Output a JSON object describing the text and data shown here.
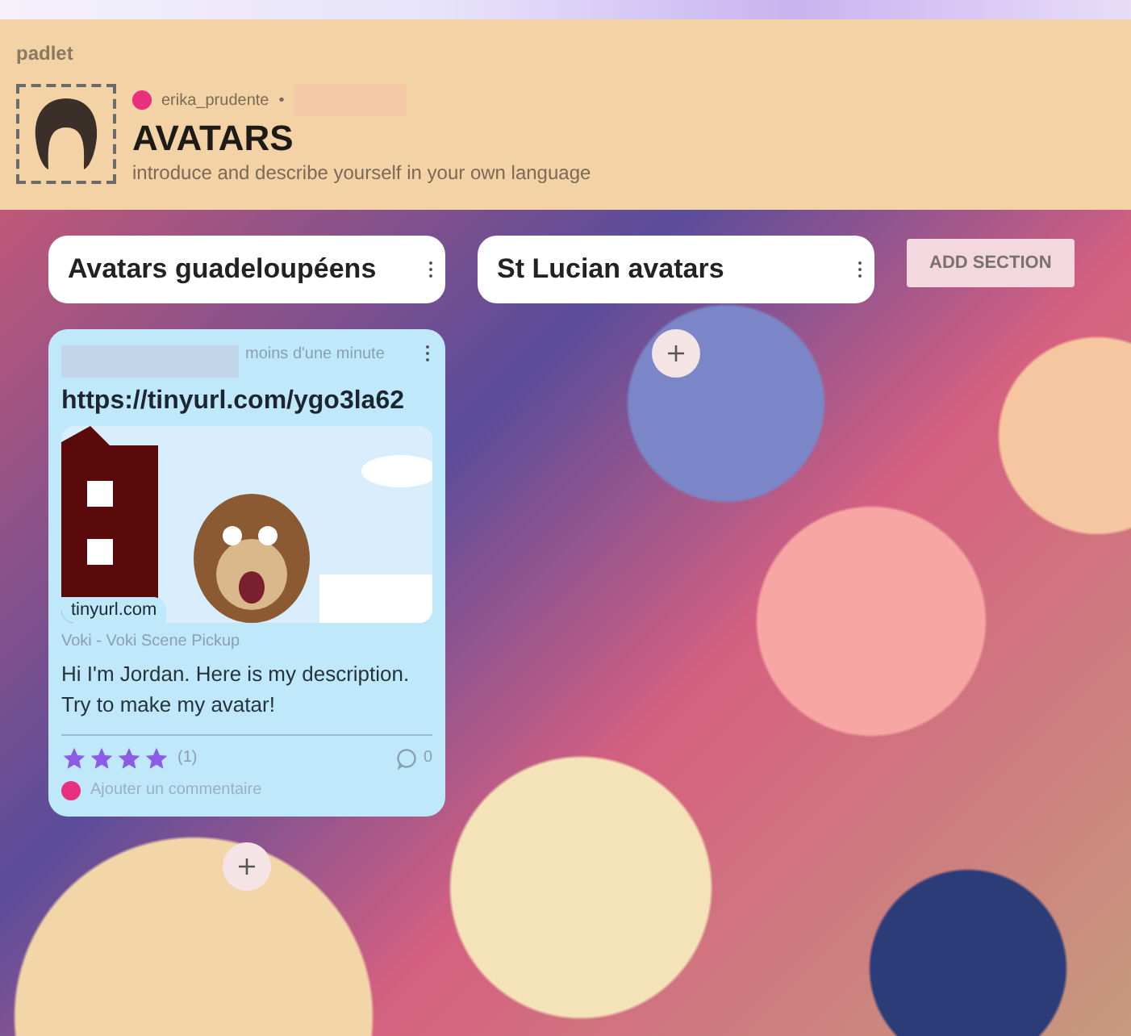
{
  "brand": "padlet",
  "header": {
    "author": "erika_prudente",
    "separator": "•",
    "title": "AVATARS",
    "description": "introduce and describe yourself in your own language"
  },
  "sections": [
    {
      "title": "Avatars guadeloupéens",
      "posts": [
        {
          "time": "moins d'une minute",
          "link": "https://tinyurl.com/ygo3la62",
          "domain": "tinyurl.com",
          "source": "Voki - Voki Scene Pickup",
          "body": "Hi I'm Jordan. Here is my description. Try to make my avatar!",
          "stars": 4,
          "rating_count": "(1)",
          "comment_count": "0",
          "comment_placeholder": "Ajouter un commentaire"
        }
      ]
    },
    {
      "title": "St Lucian avatars"
    }
  ],
  "add_section": "ADD SECTION"
}
